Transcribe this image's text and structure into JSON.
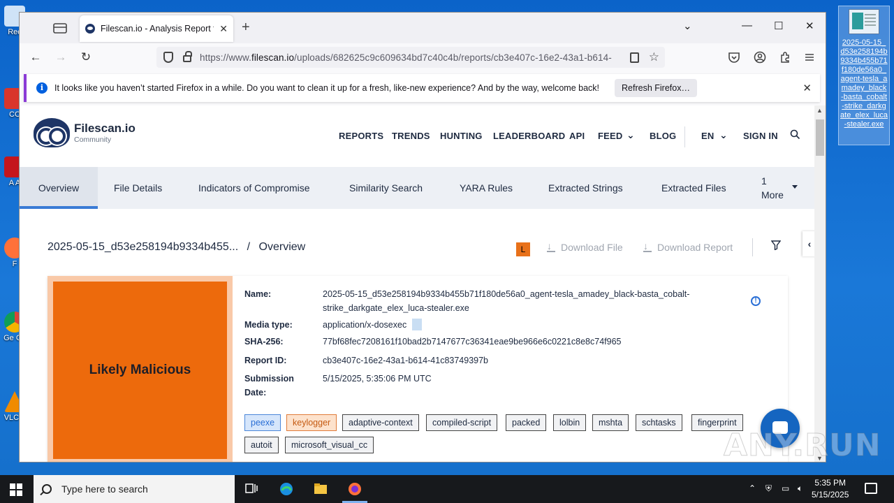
{
  "browser": {
    "tab_title": "Filescan.io - Analysis Report for",
    "url_prefix": "https://www.",
    "url_domain": "filescan.io",
    "url_rest": "/uploads/682625c9c609634bd7c40c4b/reports/cb3e407c-16e2-43a1-b614-",
    "notice_text": "It looks like you haven’t started Firefox in a while. Do you want to clean it up for a fresh, like-new experience? And by the way, welcome back!",
    "notice_button": "Refresh Firefox…"
  },
  "site": {
    "brand": "Filescan.io",
    "brand_sub": "Community",
    "nav": [
      "REPORTS",
      "TRENDS",
      "HUNTING",
      "LEADERBOARD",
      "API",
      "FEED",
      "BLOG",
      "EN",
      "SIGN IN"
    ],
    "tabs": [
      "Overview",
      "File Details",
      "Indicators of Compromise",
      "Similarity Search",
      "YARA Rules",
      "Extracted Strings",
      "Extracted Files"
    ],
    "more_count": "1",
    "more_label": "More"
  },
  "report": {
    "crumb_file": "2025-05-15_d53e258194b9334b455...",
    "crumb_sep": "/",
    "crumb_page": "Overview",
    "badge": "L",
    "download_file": "Download File",
    "download_report": "Download Report",
    "verdict": "Likely Malicious",
    "labels": {
      "name": "Name:",
      "media": "Media type:",
      "sha": "SHA-256:",
      "report_id": "Report ID:",
      "submission1": "Submission",
      "submission2": "Date:"
    },
    "name_line1": "2025-05-15_d53e258194b9334b455b71f180de56a0_agent-tesla_amadey_black-basta_cobalt-",
    "name_line2": "strike_darkgate_elex_luca-stealer.exe",
    "media_type": "application/x-dosexec",
    "sha256": "77bf68fec7208161f10bad2b7147677c36341eae9be966e6c0221c8e8c74f965",
    "report_id": "cb3e407c-16e2-43a1-b614-41c83749397b",
    "submission_date": "5/15/2025, 5:35:06 PM UTC",
    "tags": [
      "peexe",
      "keylogger",
      "adaptive-context",
      "compiled-script",
      "packed",
      "lolbin",
      "mshta",
      "schtasks",
      "fingerprint",
      "autoit",
      "microsoft_visual_cc"
    ]
  },
  "desktop": {
    "file_name": "2025-05-15_d53e258194b9334b455b71f180de56a0_agent-tesla_amadey_black-basta_cobalt-strike_darkgate_elex_luca-stealer.exe",
    "icons": [
      "Rec",
      "CC",
      "A A",
      "F",
      "Ge Ch",
      "VLC p"
    ]
  },
  "taskbar": {
    "search_placeholder": "Type here to search",
    "time": "5:35 PM",
    "date": "5/15/2025"
  },
  "watermark": "ANY.RUN"
}
